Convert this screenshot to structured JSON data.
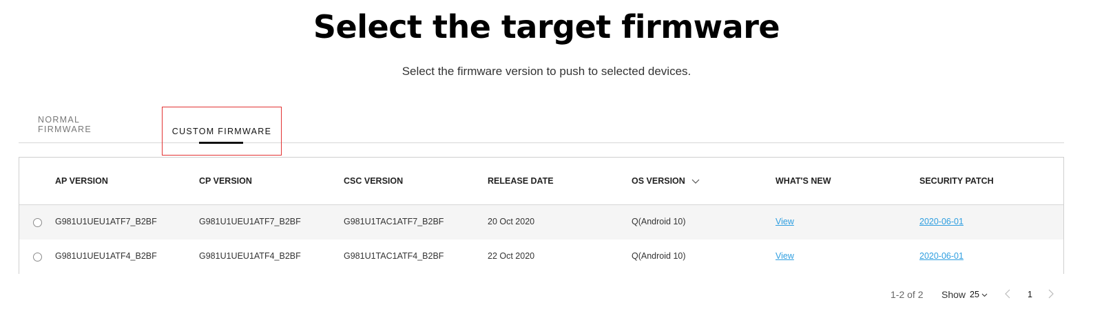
{
  "header": {
    "title": "Select the target firmware",
    "subtitle": "Select the firmware version to push to selected devices."
  },
  "tabs": [
    {
      "label": "NORMAL FIRMWARE",
      "active": false
    },
    {
      "label": "CUSTOM FIRMWARE",
      "active": true
    }
  ],
  "table": {
    "columns": [
      "AP VERSION",
      "CP VERSION",
      "CSC VERSION",
      "RELEASE DATE",
      "OS VERSION",
      "WHAT'S NEW",
      "SECURITY PATCH"
    ],
    "sort_icon": "chevron-down-icon",
    "rows": [
      {
        "ap": "G981U1UEU1ATF7_B2BF",
        "cp": "G981U1UEU1ATF7_B2BF",
        "csc": "G981U1TAC1ATF7_B2BF",
        "release": "20 Oct 2020",
        "os": "Q(Android 10)",
        "whats_new": "View",
        "patch": "2020-06-01"
      },
      {
        "ap": "G981U1UEU1ATF4_B2BF",
        "cp": "G981U1UEU1ATF4_B2BF",
        "csc": "G981U1TAC1ATF4_B2BF",
        "release": "22 Oct 2020",
        "os": "Q(Android 10)",
        "whats_new": "View",
        "patch": "2020-06-01"
      }
    ]
  },
  "pagination": {
    "range": "1-2 of 2",
    "show_label": "Show",
    "page_size": "25",
    "current_page": "1"
  },
  "colors": {
    "accent_link": "#2e9ee0",
    "highlight_border": "#e23131"
  }
}
